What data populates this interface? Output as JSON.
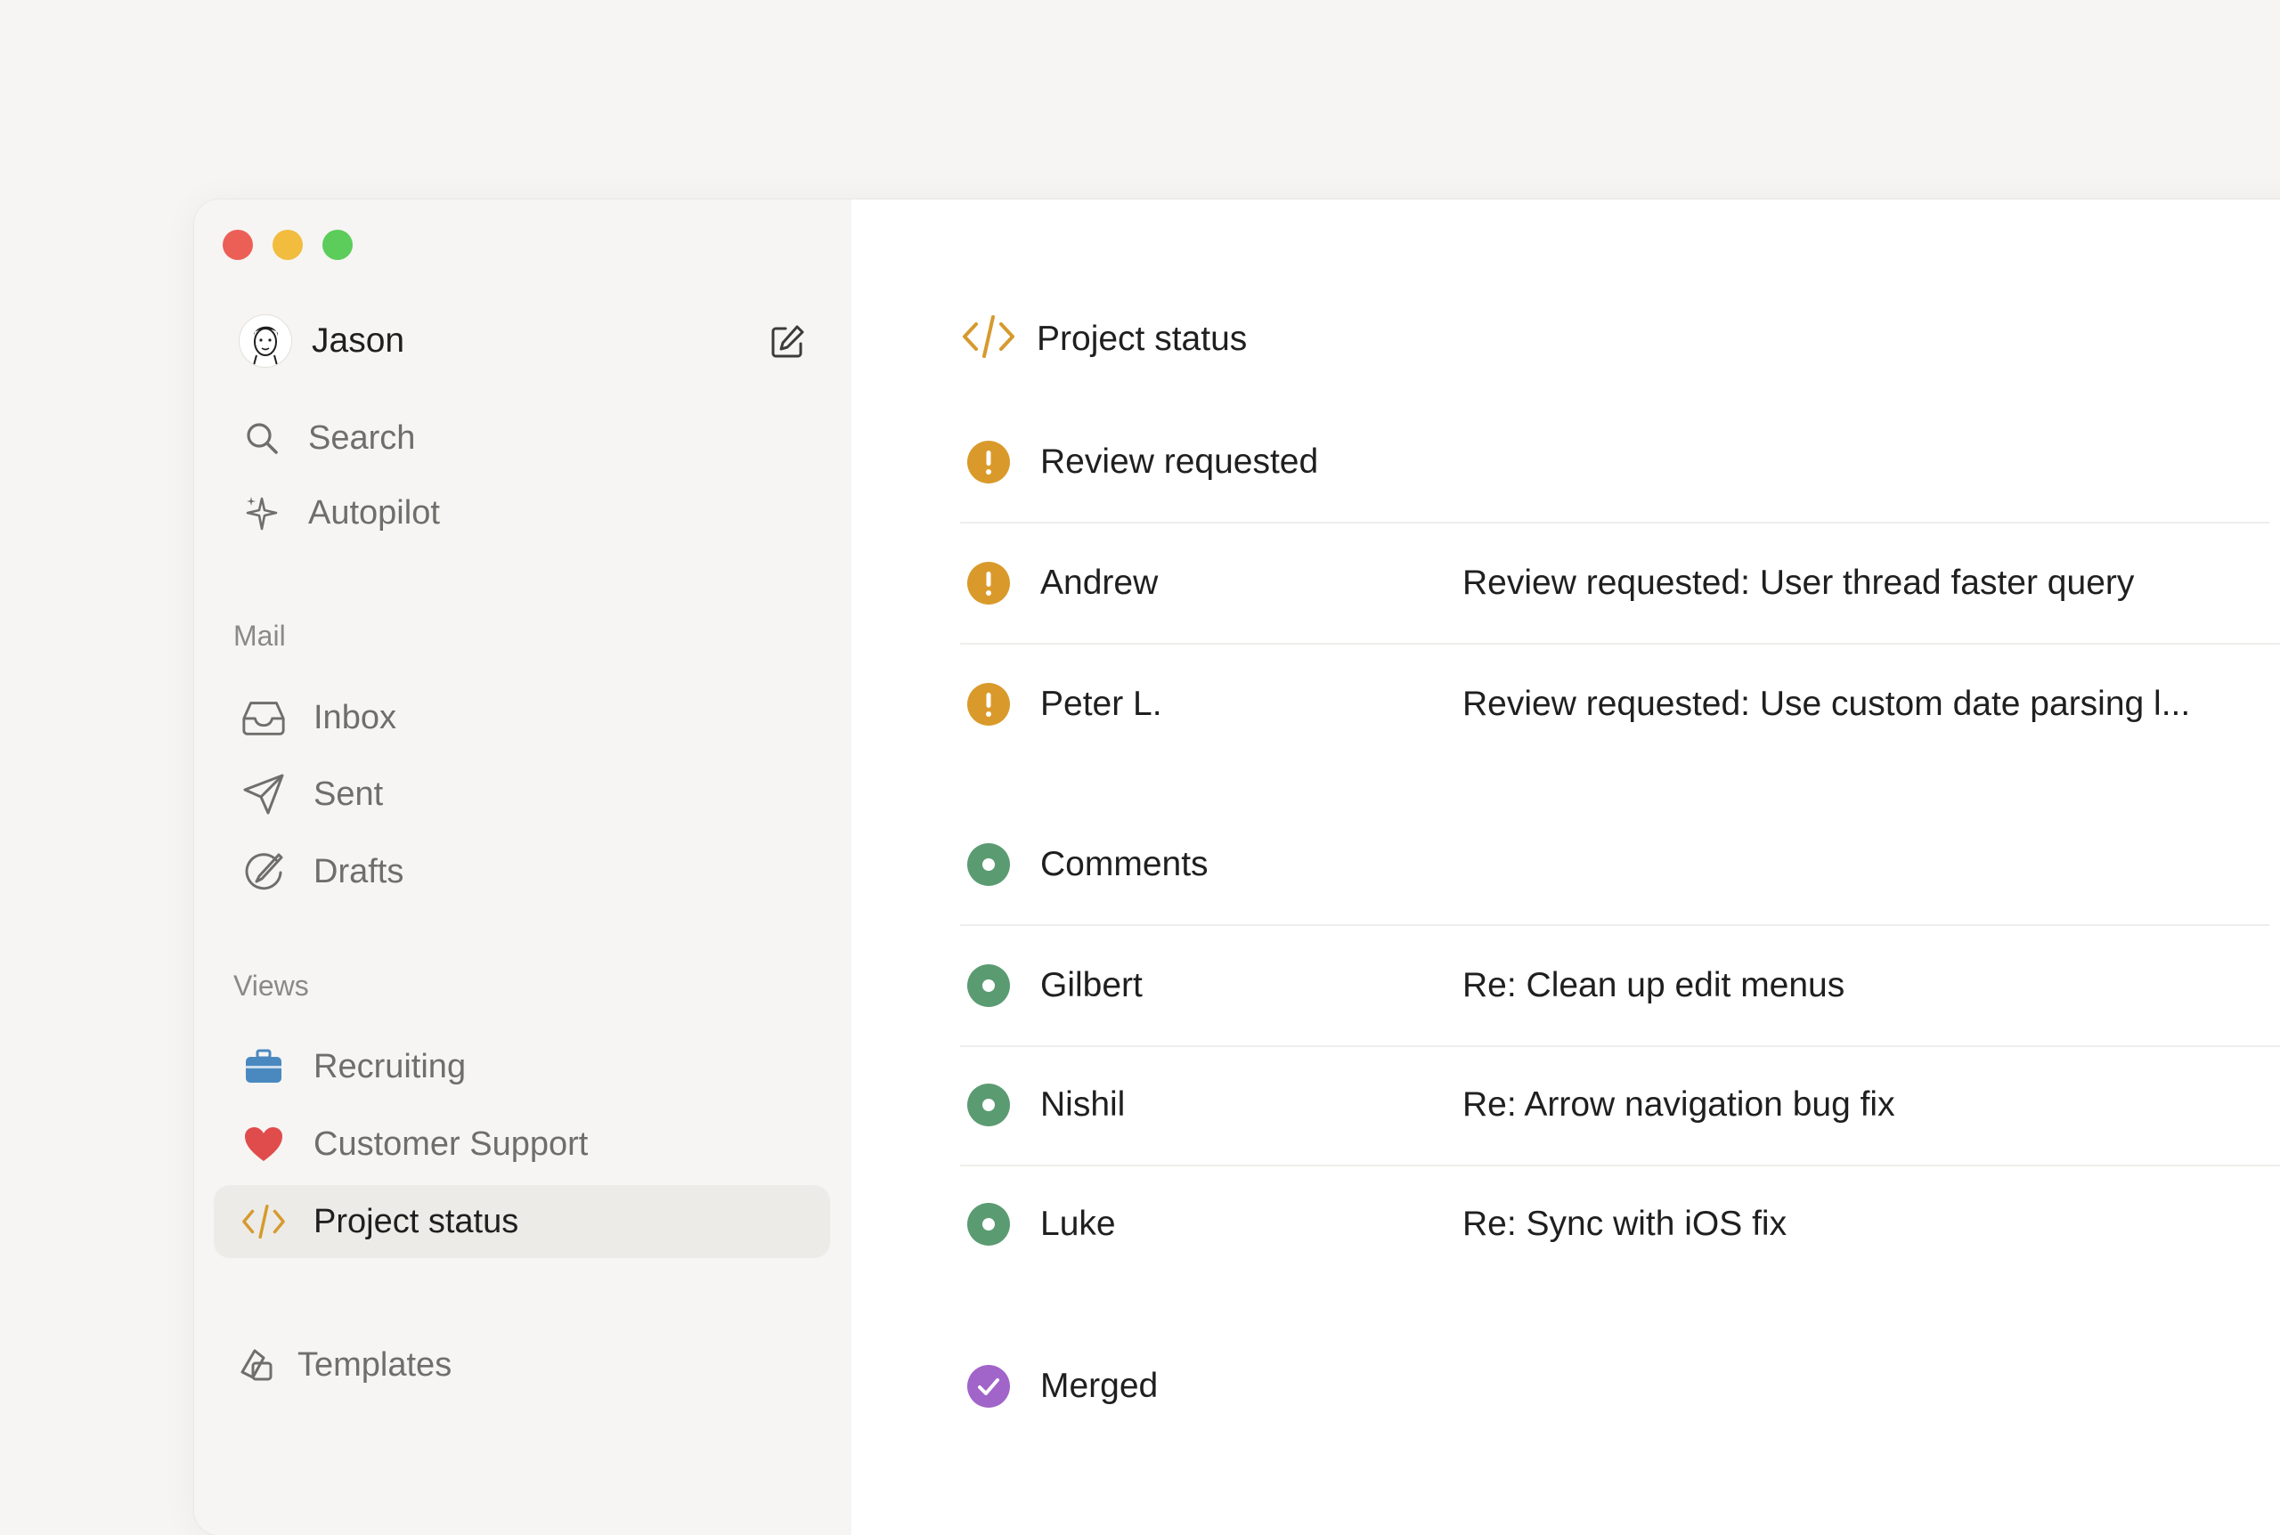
{
  "user": {
    "name": "Jason"
  },
  "nav_top": [
    {
      "label": "Search"
    },
    {
      "label": "Autopilot"
    }
  ],
  "mail": {
    "label": "Mail",
    "items": [
      {
        "label": "Inbox"
      },
      {
        "label": "Sent"
      },
      {
        "label": "Drafts"
      }
    ]
  },
  "views": {
    "label": "Views",
    "items": [
      {
        "label": "Recruiting"
      },
      {
        "label": "Customer Support"
      },
      {
        "label": "Project status"
      }
    ]
  },
  "extra": [
    {
      "label": "Templates"
    }
  ],
  "main": {
    "title": "Project status",
    "groups": [
      {
        "label": "Review requested",
        "rows": [
          {
            "name": "Andrew",
            "subject": "Review requested: User thread faster query"
          },
          {
            "name": "Peter L.",
            "subject": "Review requested: Use custom date parsing l..."
          }
        ]
      },
      {
        "label": "Comments",
        "rows": [
          {
            "name": "Gilbert",
            "subject": "Re: Clean up edit menus"
          },
          {
            "name": "Nishil",
            "subject": "Re: Arrow navigation bug fix"
          },
          {
            "name": "Luke",
            "subject": "Re: Sync with iOS fix"
          }
        ]
      },
      {
        "label": "Merged",
        "rows": []
      }
    ]
  },
  "colors": {
    "warning": "#d99a2b",
    "ok": "#5b9b72",
    "merged": "#a165c9",
    "code_accent": "#d69a2e",
    "briefcase": "#4a89c0",
    "heart": "#e04c4c"
  }
}
